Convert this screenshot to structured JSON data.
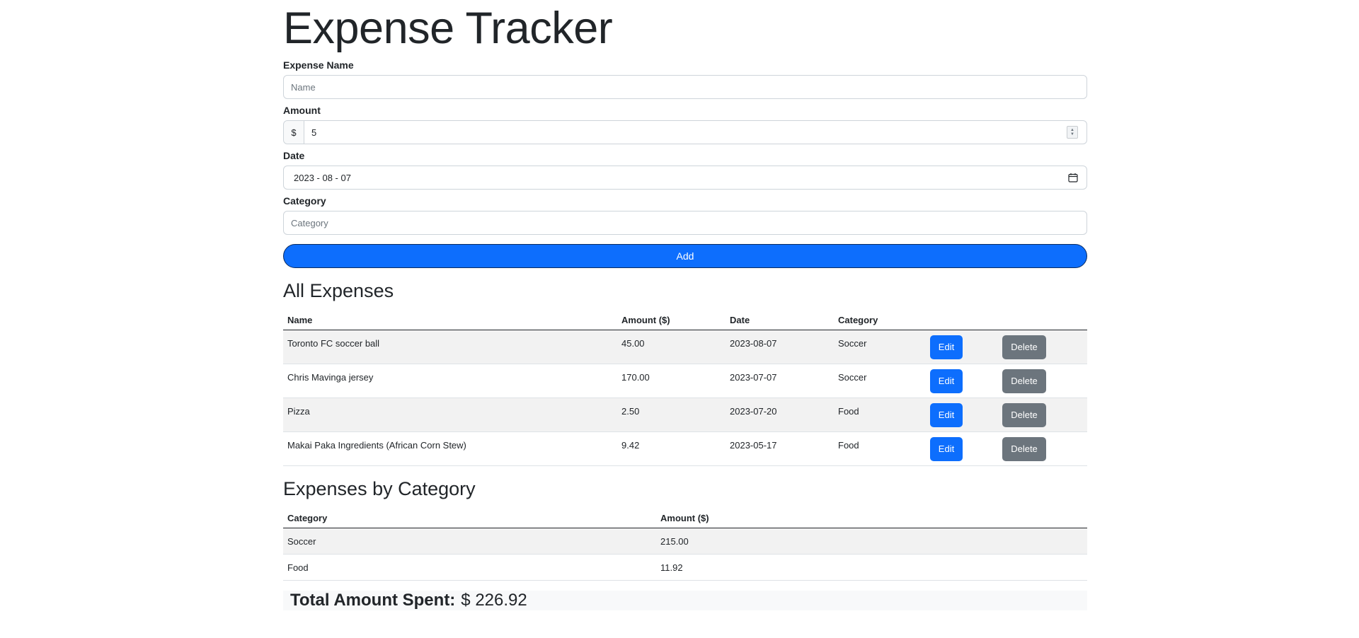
{
  "app": {
    "title": "Expense Tracker"
  },
  "form": {
    "name_label": "Expense Name",
    "name_placeholder": "Name",
    "amount_label": "Amount",
    "amount_prefix": "$",
    "amount_value": "5",
    "date_label": "Date",
    "date_value": "2023 - 08 - 07",
    "category_label": "Category",
    "category_placeholder": "Category",
    "add_label": "Add"
  },
  "all_expenses": {
    "title": "All Expenses",
    "headers": [
      "Name",
      "Amount ($)",
      "Date",
      "Category"
    ],
    "rows": [
      {
        "name": "Toronto FC soccer ball",
        "amount": "45.00",
        "date": "2023-08-07",
        "category": "Soccer",
        "edit": "Edit",
        "delete": "Delete"
      },
      {
        "name": "Chris Mavinga jersey",
        "amount": "170.00",
        "date": "2023-07-07",
        "category": "Soccer",
        "edit": "Edit",
        "delete": "Delete"
      },
      {
        "name": "Pizza",
        "amount": "2.50",
        "date": "2023-07-20",
        "category": "Food",
        "edit": "Edit",
        "delete": "Delete"
      },
      {
        "name": "Makai Paka Ingredients (African Corn Stew)",
        "amount": "9.42",
        "date": "2023-05-17",
        "category": "Food",
        "edit": "Edit",
        "delete": "Delete"
      }
    ]
  },
  "by_category": {
    "title": "Expenses by Category",
    "headers": [
      "Category",
      "Amount ($)"
    ],
    "rows": [
      {
        "category": "Soccer",
        "amount": "215.00"
      },
      {
        "category": "Food",
        "amount": "11.92"
      }
    ]
  },
  "total": {
    "label": "Total Amount Spent:",
    "value": "$ 226.92"
  },
  "colors": {
    "primary": "#0d6efd",
    "secondary": "#6c757d",
    "stripe": "#f2f2f2"
  },
  "icons": {
    "date_picker": "calendar-icon",
    "amount_stepper": "spinner-icon"
  }
}
